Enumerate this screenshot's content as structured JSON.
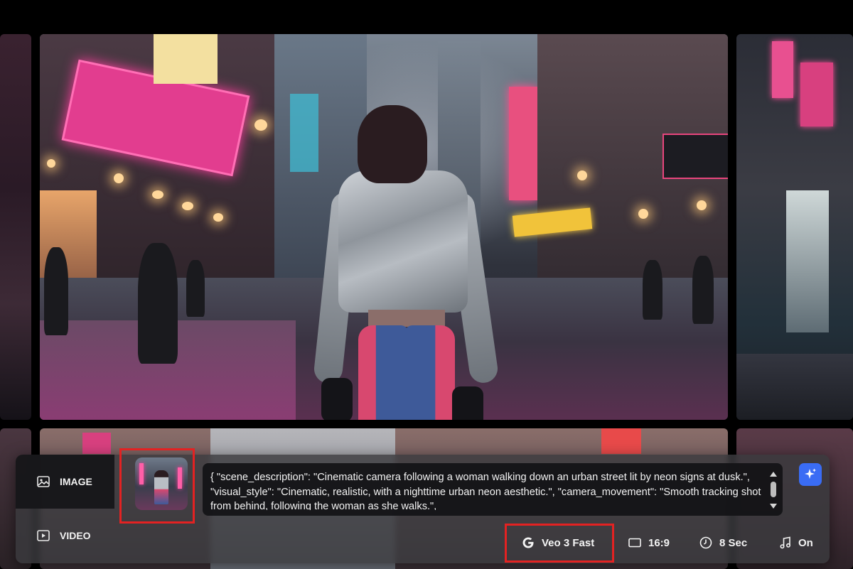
{
  "gallery": {
    "main_image_alt": "",
    "tiles": 6
  },
  "composer": {
    "modes": [
      {
        "label": "IMAGE",
        "icon": "image-icon",
        "active": true
      },
      {
        "label": "VIDEO",
        "icon": "play-icon",
        "active": false
      }
    ],
    "reference_thumbnail_icon": "reference-thumbnail",
    "prompt": {
      "value": "{ \"scene_description\": \"Cinematic camera following a woman walking down an urban street lit by neon signs at dusk.\", \"visual_style\": \"Cinematic, realistic, with a nighttime urban neon aesthetic.\", \"camera_movement\": \"Smooth tracking shot from behind, following the woman as she walks.\","
    },
    "enhance_icon": "sparkle-icon",
    "options": {
      "model": {
        "label": "Veo 3 Fast",
        "icon": "google-icon"
      },
      "aspect_ratio": {
        "label": "16:9",
        "icon": "rectangle-icon"
      },
      "duration": {
        "label": "8 Sec",
        "icon": "clock-icon"
      },
      "audio": {
        "label": "On",
        "icon": "music-note-icon"
      }
    },
    "highlight_color": "#e32222",
    "accent_color": "#3a6cf4"
  }
}
